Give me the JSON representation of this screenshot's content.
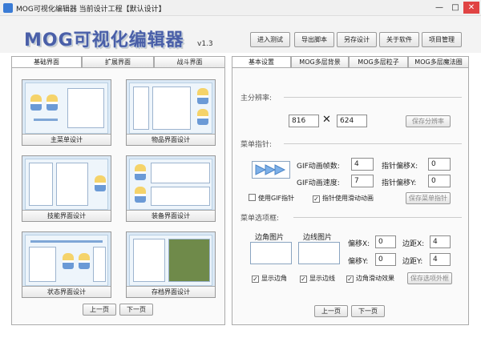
{
  "window": {
    "title": "MOG可视化编辑器  当前设计工程【默认设计】",
    "minimize": "—",
    "maximize": "□",
    "close": "✕"
  },
  "header": {
    "logo_text": "MOG可视化编辑器",
    "version": "v1.3",
    "buttons": [
      "进入测试",
      "导出脚本",
      "另存设计",
      "关于软件",
      "项目管理"
    ]
  },
  "left_panel": {
    "tabs": [
      "基础界面",
      "扩展界面",
      "战斗界面"
    ],
    "thumbnails": [
      "主菜单设计",
      "物品界面设计",
      "技能界面设计",
      "装备界面设计",
      "状态界面设计",
      "存档界面设计"
    ],
    "prev": "上一页",
    "next": "下一页"
  },
  "right_panel": {
    "tabs": [
      "基本设置",
      "MOG多层背景",
      "MOG多层粒子",
      "MOG多层魔法圈"
    ],
    "resolution": {
      "section": "主分辨率:",
      "width": "816",
      "times": "✕",
      "height": "624",
      "save": "保存分辨率"
    },
    "pointer": {
      "section": "菜单指针:",
      "gif_frames_label": "GIF动画帧数:",
      "gif_frames": "4",
      "gif_speed_label": "GIF动画速度:",
      "gif_speed": "7",
      "offset_x_label": "指针偏移X:",
      "offset_x": "0",
      "offset_y_label": "指针偏移Y:",
      "offset_y": "0",
      "use_gif": "使用GIF指针",
      "slide_anim": "指针使用滑动动画",
      "save": "保存菜单指针"
    },
    "frame": {
      "section": "菜单选项框:",
      "corner_label": "边角图片",
      "edge_label": "边线图片",
      "offset_x_label": "偏移X:",
      "offset_x": "0",
      "offset_y_label": "偏移Y:",
      "offset_y": "0",
      "margin_x_label": "边距X:",
      "margin_x": "4",
      "margin_y_label": "边距Y:",
      "margin_y": "4",
      "show_corner": "显示边角",
      "show_edge": "显示边线",
      "corner_slide": "边角滑动效果",
      "save": "保存选项外框"
    },
    "prev": "上一页",
    "next": "下一页"
  }
}
